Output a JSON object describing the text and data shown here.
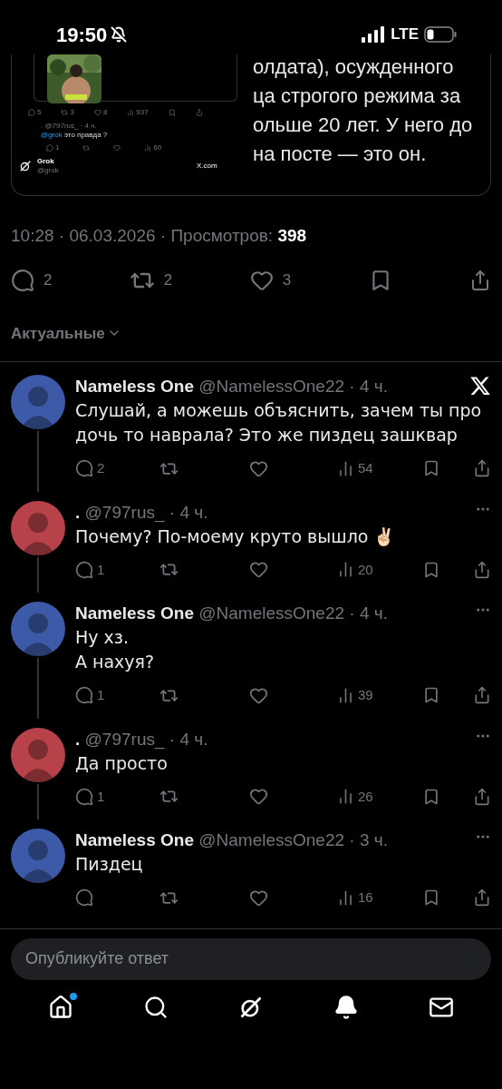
{
  "status_bar": {
    "time": "19:50",
    "network": "LTE"
  },
  "attachment": {
    "mini_post_counts": [
      "5",
      "3",
      "8",
      "937"
    ],
    "mini_reply": {
      "meta": ". @797rus_ · 4 ч.",
      "mention": "@grok",
      "text": "это правда ?",
      "counts": [
        "1",
        "60"
      ]
    },
    "source": {
      "name": "Grok",
      "handle": "@grok",
      "site": "X.com"
    },
    "zoomed_lines": [
      "олдата), осужденного",
      "ца строгого режима за",
      "ольше 20 лет. У него до",
      "на посте — это он."
    ]
  },
  "post_meta": {
    "text": "10:28 · 06.03.2026 · Просмотров:",
    "views": "398"
  },
  "post_stats": {
    "replies": "2",
    "reposts": "2",
    "likes": "3"
  },
  "sort": {
    "label": "Актуальные"
  },
  "replies": [
    {
      "name": "Nameless One",
      "meta": "@NamelessOne22 · 4 ч.",
      "kind": "logo",
      "color": "#3c5aa8",
      "lines": [
        "Слушай, а можешь объяснить, зачем ты про дочь то наврала? Это же пиздец зашквар"
      ],
      "replies": "2",
      "views": "54"
    },
    {
      "name": ".",
      "meta": "@797rus_ · 4 ч.",
      "kind": "more",
      "color": "#b8424a",
      "lines": [
        "Почему? По-моему круто вышло ✌🏻"
      ],
      "replies": "1",
      "views": "20"
    },
    {
      "name": "Nameless One",
      "meta": "@NamelessOne22 · 4 ч.",
      "kind": "more",
      "color": "#3c5aa8",
      "lines": [
        "Ну хз.",
        "А нахуя?"
      ],
      "replies": "1",
      "views": "39"
    },
    {
      "name": ".",
      "meta": "@797rus_ · 4 ч.",
      "kind": "more",
      "color": "#b8424a",
      "lines": [
        "Да просто"
      ],
      "replies": "1",
      "views": "26"
    },
    {
      "name": "Nameless One",
      "meta": "@NamelessOne22 · 3 ч.",
      "kind": "more",
      "color": "#3c5aa8",
      "lines": [
        "Пиздец"
      ],
      "views": "16"
    }
  ],
  "composer": {
    "placeholder": "Опубликуйте ответ"
  },
  "nav": [
    {
      "kind": "home",
      "badge": true
    },
    {
      "kind": "search",
      "badge": false
    },
    {
      "kind": "grok",
      "badge": false
    },
    {
      "kind": "bell",
      "badge": false
    },
    {
      "kind": "mail",
      "badge": false
    }
  ]
}
